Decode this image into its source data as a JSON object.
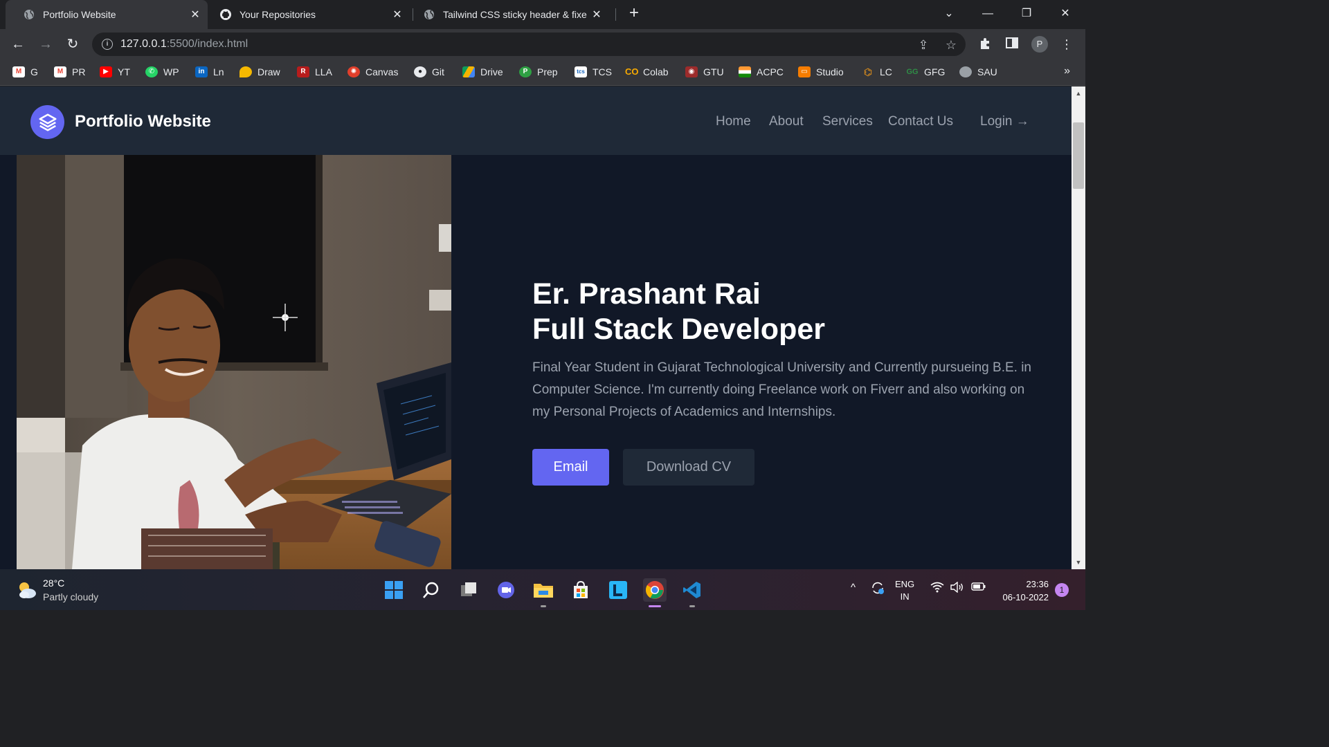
{
  "browser": {
    "tabs": [
      {
        "title": "Portfolio Website",
        "active": true
      },
      {
        "title": "Your Repositories",
        "active": false
      },
      {
        "title": "Tailwind CSS sticky header & fixe",
        "active": false
      }
    ],
    "url_host": "127.0.0.1",
    "url_rest": ":5500/index.html",
    "profile_initial": "P"
  },
  "bookmarks": [
    "G",
    "PR",
    "YT",
    "WP",
    "Ln",
    "Draw",
    "LLA",
    "Canvas",
    "Git",
    "Drive",
    "Prep",
    "TCS",
    "Colab",
    "GTU",
    "ACPC",
    "Studio",
    "LC",
    "GFG",
    "SAU"
  ],
  "site": {
    "title": "Portfolio Website",
    "nav": [
      "Home",
      "About",
      "Services",
      "Contact Us"
    ],
    "login": "Login",
    "hero": {
      "name": "Er. Prashant Rai",
      "role": "Full Stack Developer",
      "description": "Final Year Student in Gujarat Technological University and Currently pursueing B.E. in Computer Science. I'm currently doing Freelance work on Fiverr and also working on my Personal Projects of Academics and Internships.",
      "email_btn": "Email",
      "cv_btn": "Download CV"
    },
    "accent": "#6366f1"
  },
  "taskbar": {
    "temperature": "28°C",
    "weather": "Partly cloudy",
    "lang_top": "ENG",
    "lang_bottom": "IN",
    "time": "23:36",
    "date": "06-10-2022",
    "notifications": "1"
  }
}
